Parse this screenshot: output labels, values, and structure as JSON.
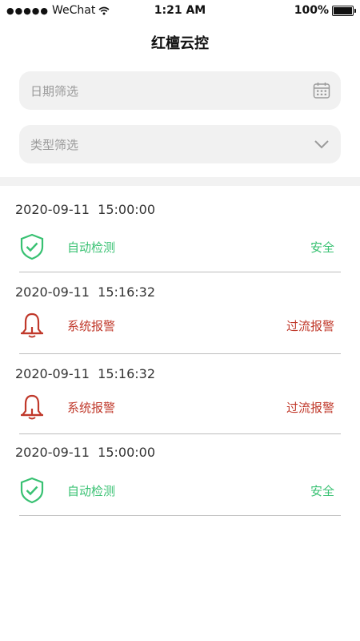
{
  "status_bar": {
    "carrier": "WeChat",
    "time": "1:21 AM",
    "battery": "100%"
  },
  "page": {
    "title": "红檀云控"
  },
  "filters": {
    "date_placeholder": "日期筛选",
    "type_placeholder": "类型筛选"
  },
  "records": [
    {
      "timestamp": "2020-09-11  15:00:00",
      "type": "自动检测",
      "status": "安全",
      "icon": "shield-check-icon",
      "color": "#38c172"
    },
    {
      "timestamp": "2020-09-11  15:16:32",
      "type": "系统报警",
      "status": "过流报警",
      "icon": "bell-icon",
      "color": "#c0392b"
    },
    {
      "timestamp": "2020-09-11  15:16:32",
      "type": "系统报警",
      "status": "过流报警",
      "icon": "bell-icon",
      "color": "#c0392b"
    },
    {
      "timestamp": "2020-09-11  15:00:00",
      "type": "自动检测",
      "status": "安全",
      "icon": "shield-check-icon",
      "color": "#38c172"
    }
  ]
}
